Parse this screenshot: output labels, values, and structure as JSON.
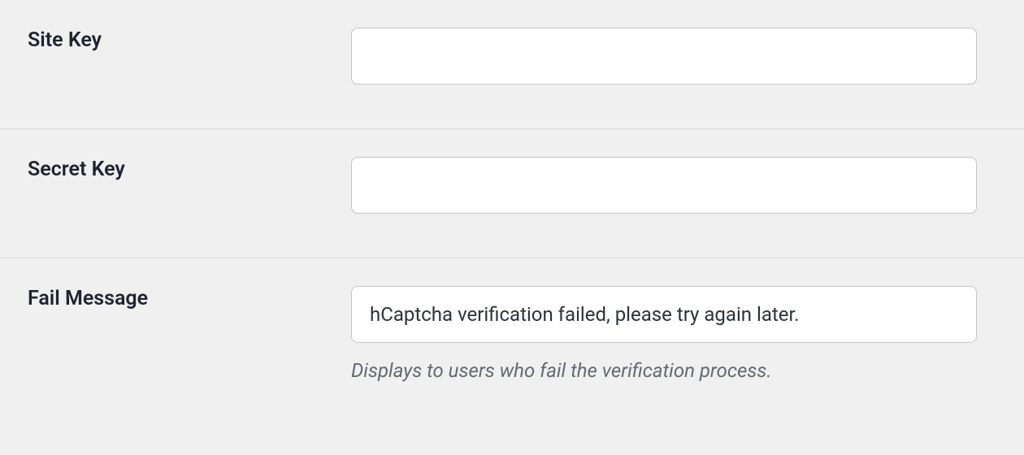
{
  "form": {
    "rows": [
      {
        "label": "Site Key",
        "value": "",
        "description": ""
      },
      {
        "label": "Secret Key",
        "value": "",
        "description": ""
      },
      {
        "label": "Fail Message",
        "value": "hCaptcha verification failed, please try again later.",
        "description": "Displays to users who fail the verification process."
      }
    ]
  }
}
